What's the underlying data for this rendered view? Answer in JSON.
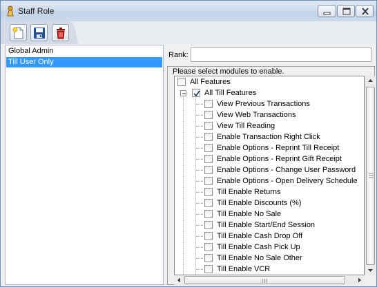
{
  "window": {
    "title": "Staff Role",
    "icon": "app-icon",
    "controls": [
      "minimize-icon",
      "maximize-icon",
      "close-icon"
    ]
  },
  "toolbar": {
    "buttons": [
      {
        "name": "new",
        "icon": "new-document-icon"
      },
      {
        "name": "save",
        "icon": "floppy-disk-icon"
      },
      {
        "name": "delete",
        "icon": "trash-icon"
      }
    ]
  },
  "roles": {
    "items": [
      {
        "label": "Global Admin",
        "selected": false
      },
      {
        "label": "Till User Only",
        "selected": true
      }
    ]
  },
  "rank": {
    "label": "Rank:",
    "value": ""
  },
  "modules": {
    "caption": "Please select modules to enable.",
    "all_features": {
      "label": "All Features",
      "checked": false
    },
    "all_till_features": {
      "label": "All Till Features",
      "checked": true,
      "expanded": true
    },
    "items": [
      {
        "label": "View Previous Transactions",
        "checked": false
      },
      {
        "label": "View Web Transactions",
        "checked": false
      },
      {
        "label": "View Till Reading",
        "checked": false
      },
      {
        "label": "Enable Transaction Right Click",
        "checked": false
      },
      {
        "label": "Enable Options - Reprint Till Receipt",
        "checked": false
      },
      {
        "label": "Enable Options - Reprint Gift Receipt",
        "checked": false
      },
      {
        "label": "Enable Options - Change User Password",
        "checked": false
      },
      {
        "label": "Enable Options - Open Delivery Schedule",
        "checked": false
      },
      {
        "label": "Till Enable Returns",
        "checked": false
      },
      {
        "label": "Till Enable Discounts (%)",
        "checked": false
      },
      {
        "label": "Till Enable No Sale",
        "checked": false
      },
      {
        "label": "Till Enable Start/End Session",
        "checked": false
      },
      {
        "label": "Till Enable Cash Drop Off",
        "checked": false
      },
      {
        "label": "Till Enable Cash Pick Up",
        "checked": false
      },
      {
        "label": "Till Enable No Sale Other",
        "checked": false
      },
      {
        "label": "Till Enable VCR",
        "checked": false
      }
    ]
  },
  "colors": {
    "selection": "#3399ff",
    "titlebar": "#c2d3e8",
    "save_icon": "#1c4f9c",
    "delete_icon": "#c0221a"
  }
}
